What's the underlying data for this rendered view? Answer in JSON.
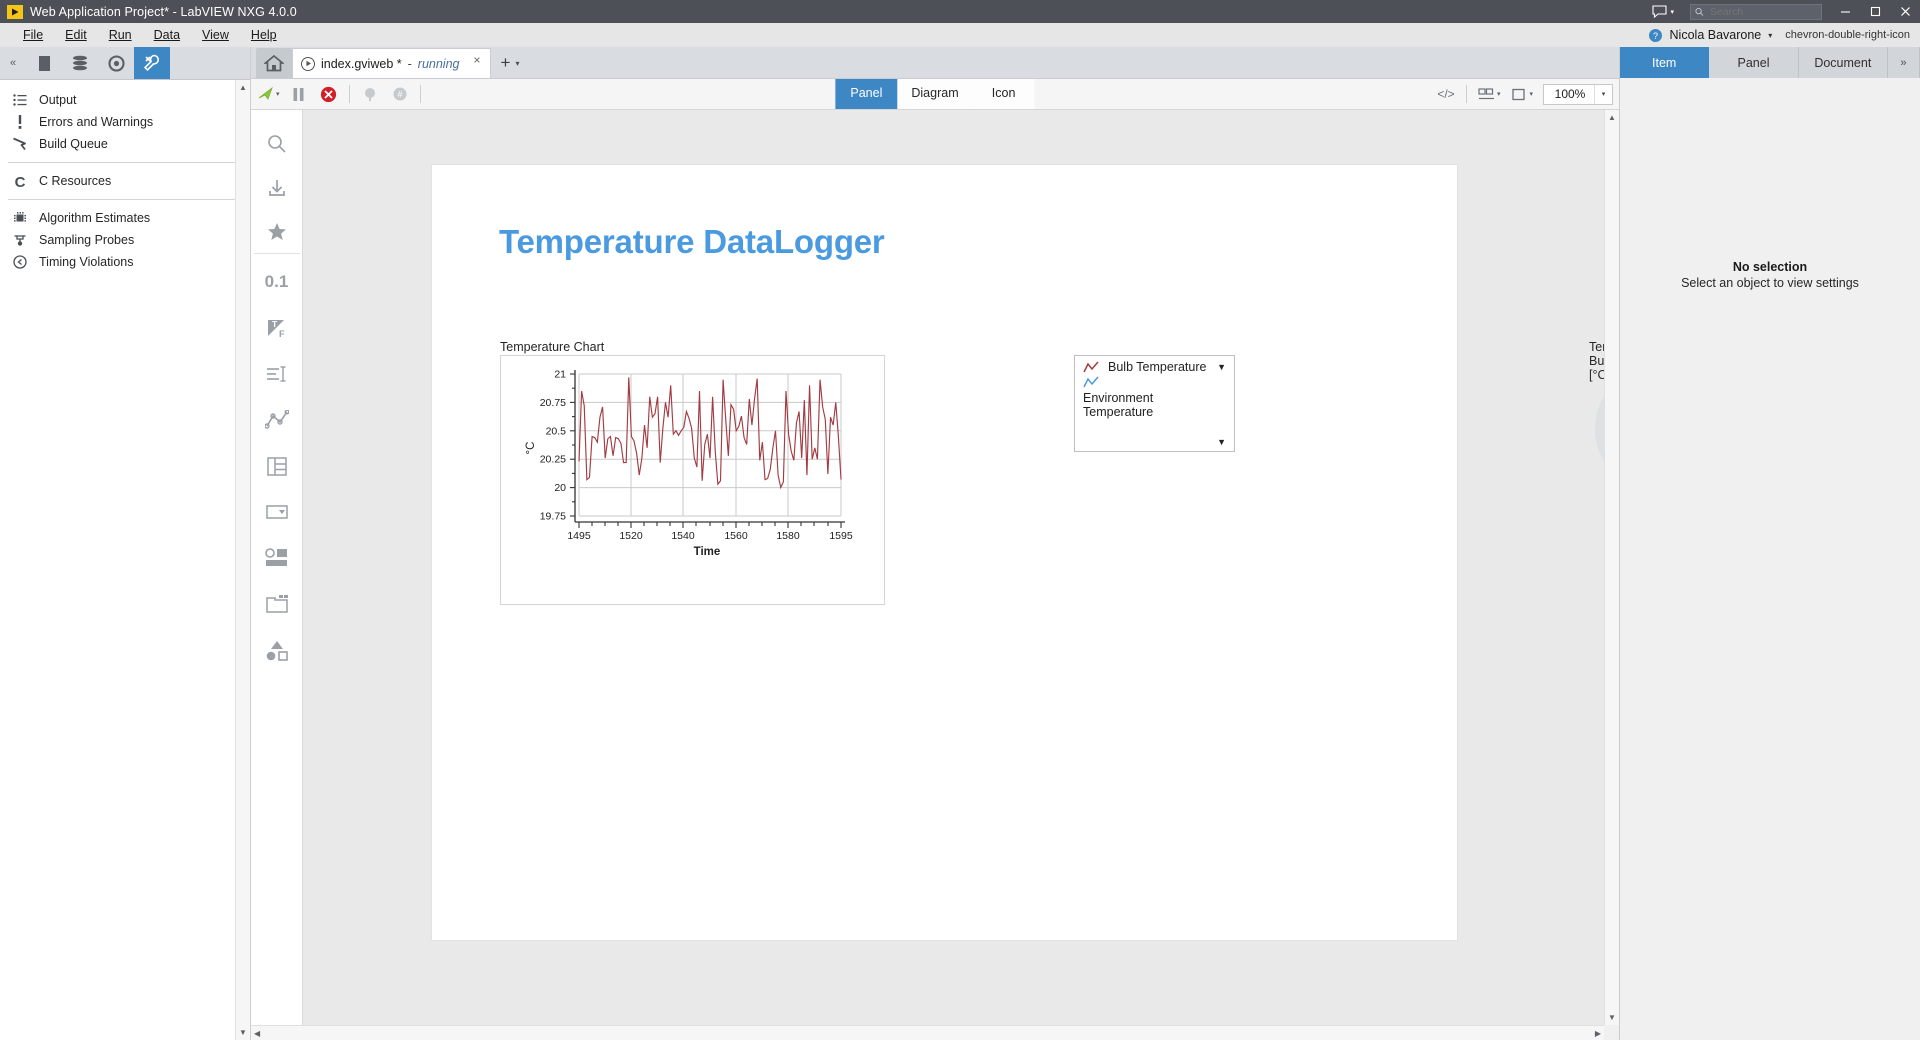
{
  "window": {
    "title": "Web Application Project* - LabVIEW NXG 4.0.0",
    "logo_icon": "labview-play-icon",
    "minimize_icon": "minimize-icon",
    "maximize_icon": "maximize-icon",
    "close_icon": "close-icon",
    "chat_icon": "chat-bubble-icon",
    "chat_caret": "▾",
    "user_icon": "help-circle-icon",
    "user_name": "Nicola Bavarone",
    "user_caret": "▾",
    "expand_icon": "chevron-double-right-icon"
  },
  "search": {
    "placeholder": "Search",
    "value": "",
    "icon": "search-icon"
  },
  "menu": {
    "items": [
      {
        "label": "File",
        "mnemonic": "F"
      },
      {
        "label": "Edit",
        "mnemonic": "E"
      },
      {
        "label": "Run",
        "mnemonic": "R"
      },
      {
        "label": "Data",
        "mnemonic": "D"
      },
      {
        "label": "View",
        "mnemonic": "V"
      },
      {
        "label": "Help",
        "mnemonic": "H"
      }
    ]
  },
  "left_dock": {
    "collapse_icon": "collapse-left-icon",
    "tabs": [
      {
        "name": "files-tab",
        "icon": "document-icon",
        "active": false
      },
      {
        "name": "layers-tab",
        "icon": "stack-icon",
        "active": false
      },
      {
        "name": "debug-tab",
        "icon": "target-icon",
        "active": false
      },
      {
        "name": "tools-tab",
        "icon": "wrench-icon",
        "active": true
      }
    ],
    "items": [
      {
        "label": "Output",
        "icon": "list-icon"
      },
      {
        "label": "Errors and Warnings",
        "icon": "exclamation-icon"
      },
      {
        "label": "Build Queue",
        "icon": "hammer-icon"
      },
      {
        "label": "C Resources",
        "icon": "letter-c-icon"
      },
      {
        "label": "Algorithm Estimates",
        "icon": "chip-icon"
      },
      {
        "label": "Sampling Probes",
        "icon": "probe-icon"
      },
      {
        "label": "Timing Violations",
        "icon": "clock-back-icon"
      }
    ],
    "separators_after": [
      2,
      3
    ],
    "scroll_up": "▲",
    "scroll_down": "▼"
  },
  "doc_tabs": {
    "home_icon": "home-icon",
    "tab": {
      "run_icon": "run-state-icon",
      "name": "index.gviweb *",
      "separator": "-",
      "state": "running",
      "close_icon": "close-icon"
    },
    "add_label": "+",
    "add_caret": "▾"
  },
  "editor_toolbar": {
    "run_icon": "run-arrow-icon",
    "run_caret": "▾",
    "pause_icon": "pause-icon",
    "abort_icon": "abort-stop-icon",
    "probe_icon": "probe-watch-icon",
    "highlight_icon": "highlight-execution-icon",
    "code_icon": "code-brackets-icon",
    "align_icon": "align-objects-icon",
    "align_caret": "▾",
    "distribute_icon": "resize-objects-icon",
    "distribute_caret": "▾",
    "zoom_value": "100%",
    "zoom_caret": "▾",
    "view_tabs": [
      {
        "label": "Panel",
        "active": true
      },
      {
        "label": "Diagram",
        "active": false
      },
      {
        "label": "Icon",
        "active": false
      }
    ]
  },
  "palette": {
    "icons": [
      "search-palette-icon",
      "download-insert-icon",
      "favorites-star-icon",
      "numeric-0-1-icon",
      "boolean-tf-icon",
      "string-text-icon",
      "graph-chart-icon",
      "array-table-icon",
      "dropdown-ring-icon",
      "io-controls-icon",
      "containers-icon",
      "shapes-decorations-icon"
    ]
  },
  "panel": {
    "app_title": "Temperature DataLogger",
    "accent_color": "#4a9ae0",
    "chart_caption": "Temperature Chart",
    "gauge_caption": "Temp Bulb [°C]"
  },
  "gauge": {
    "label": "Temp Bulb [°C]",
    "track_color": "#dde1e3",
    "fill_color": "#3d87c4",
    "start_angle_deg": 0,
    "sweep_deg": 57,
    "value_fraction": 0.158
  },
  "right_panel": {
    "tabs": [
      {
        "label": "Item",
        "active": true
      },
      {
        "label": "Panel",
        "active": false
      },
      {
        "label": "Document",
        "active": false
      }
    ],
    "more_label": "»",
    "empty_title": "No selection",
    "empty_subtitle": "Select an object to view settings"
  },
  "chart_data": {
    "type": "line",
    "title": "Temperature Chart",
    "xlabel": "Time",
    "ylabel": "°C",
    "xlim": [
      1494,
      1595
    ],
    "ylim": [
      19.75,
      21
    ],
    "xticks": [
      1495,
      1520,
      1540,
      1560,
      1580,
      1595
    ],
    "yticks": [
      19.75,
      20,
      20.25,
      20.5,
      20.75,
      21
    ],
    "grid": true,
    "legend_position": "right-outside",
    "legend_box": true,
    "series": [
      {
        "name": "Bulb Temperature",
        "color": "#a23c42",
        "x": [
          1495,
          1496,
          1497,
          1498,
          1499,
          1500,
          1501,
          1502,
          1503,
          1504,
          1505,
          1506,
          1507,
          1508,
          1509,
          1510,
          1511,
          1512,
          1513,
          1514,
          1515,
          1516,
          1517,
          1518,
          1519,
          1520,
          1521,
          1522,
          1523,
          1524,
          1525,
          1526,
          1527,
          1528,
          1529,
          1530,
          1531,
          1532,
          1533,
          1534,
          1535,
          1536,
          1537,
          1538,
          1539,
          1540,
          1541,
          1542,
          1543,
          1544,
          1545,
          1546,
          1547,
          1548,
          1549,
          1550,
          1551,
          1552,
          1553,
          1554,
          1555,
          1556,
          1557,
          1558,
          1559,
          1560,
          1561,
          1562,
          1563,
          1564,
          1565,
          1566,
          1567,
          1568,
          1569,
          1570,
          1571,
          1572,
          1573,
          1574,
          1575,
          1576,
          1577,
          1578,
          1579,
          1580,
          1581,
          1582,
          1583,
          1584,
          1585,
          1586,
          1587,
          1588,
          1589,
          1590,
          1591,
          1592,
          1593,
          1594,
          1595
        ],
        "y": [
          20.23,
          20.85,
          20.72,
          20.07,
          20.09,
          20.45,
          20.44,
          20.4,
          20.62,
          20.71,
          20.26,
          20.43,
          20.45,
          20.28,
          20.44,
          20.43,
          20.39,
          20.22,
          20.22,
          20.97,
          20.45,
          20.41,
          20.3,
          20.11,
          20.26,
          20.55,
          20.35,
          20.8,
          20.62,
          20.65,
          20.8,
          20.22,
          20.52,
          20.75,
          20.62,
          20.9,
          20.47,
          20.5,
          20.46,
          20.5,
          20.53,
          20.67,
          20.61,
          20.52,
          20.26,
          20.18,
          20.85,
          20.06,
          20.38,
          20.47,
          20.26,
          20.8,
          20.32,
          20.03,
          20.06,
          20.95,
          20.6,
          20.28,
          20.73,
          20.69,
          20.5,
          20.54,
          20.63,
          20.44,
          20.38,
          20.78,
          20.55,
          20.78,
          20.96,
          20.24,
          20.4,
          20.07,
          20.08,
          20.16,
          20.35,
          20.5,
          20.11,
          20.0,
          20.05,
          20.85,
          20.47,
          20.32,
          20.24,
          20.57,
          20.67,
          20.26,
          20.77,
          20.11,
          20.9,
          20.25,
          20.35,
          20.25,
          20.95,
          20.71,
          20.6,
          20.12,
          20.62,
          20.55,
          20.75,
          20.45,
          20.07
        ]
      },
      {
        "name": "Environment Temperature",
        "color": "#4a9ae0",
        "x": [],
        "y": []
      }
    ],
    "legend_entries": [
      {
        "label": "Bulb Temperature",
        "color": "#a23c42"
      },
      {
        "label": "Environment Temperature",
        "color": "#4a9ae0"
      }
    ]
  }
}
